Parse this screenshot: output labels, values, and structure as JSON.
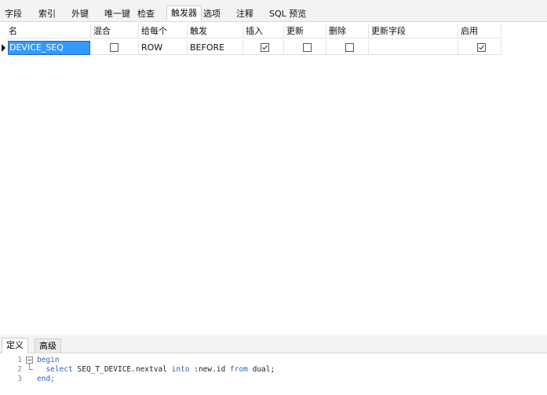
{
  "tabs": [
    {
      "label": "字段"
    },
    {
      "label": "索引"
    },
    {
      "label": "外键"
    },
    {
      "label": "唯一键"
    },
    {
      "label": "检查"
    },
    {
      "label": "触发器",
      "active": true
    },
    {
      "label": "选项"
    },
    {
      "label": "注释"
    },
    {
      "label": "SQL 预览"
    }
  ],
  "grid": {
    "headers": [
      "名",
      "混合",
      "给每个",
      "触发",
      "插入",
      "更新",
      "删除",
      "更新字段",
      "启用"
    ],
    "rows": [
      {
        "name": "DEVICE_SEQ",
        "mixed": false,
        "for_each": "ROW",
        "fire": "BEFORE",
        "insert": true,
        "update": false,
        "delete": false,
        "update_fields": "",
        "enabled": true
      }
    ]
  },
  "bottom_tabs": [
    {
      "label": "定义",
      "active": true
    },
    {
      "label": "高级",
      "active": false
    }
  ],
  "editor": {
    "lines": [
      {
        "num": "1",
        "text": "begin"
      },
      {
        "num": "2",
        "text": "  select SEQ_T_DEVICE.nextval into :new.id from dual;"
      },
      {
        "num": "3",
        "text": "end;"
      }
    ]
  }
}
